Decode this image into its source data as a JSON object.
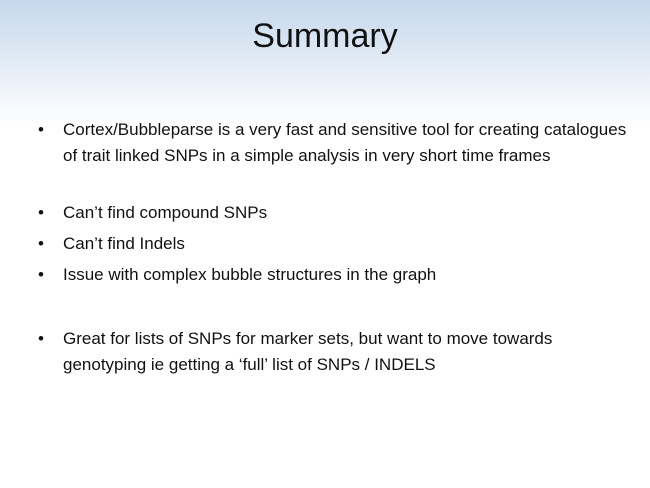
{
  "slide": {
    "title": "Summary",
    "bullet_symbol": "•",
    "bullets": [
      "Cortex/Bubbleparse is a very fast and sensitive tool for creating catalogues of trait linked SNPs in a simple analysis in very short time frames",
      "Can’t find compound SNPs",
      "Can’t find Indels",
      "Issue with complex bubble structures in the graph",
      "Great for lists of SNPs for marker sets, but want to move towards genotyping ie getting a ‘full’ list of SNPs / INDELS"
    ]
  }
}
